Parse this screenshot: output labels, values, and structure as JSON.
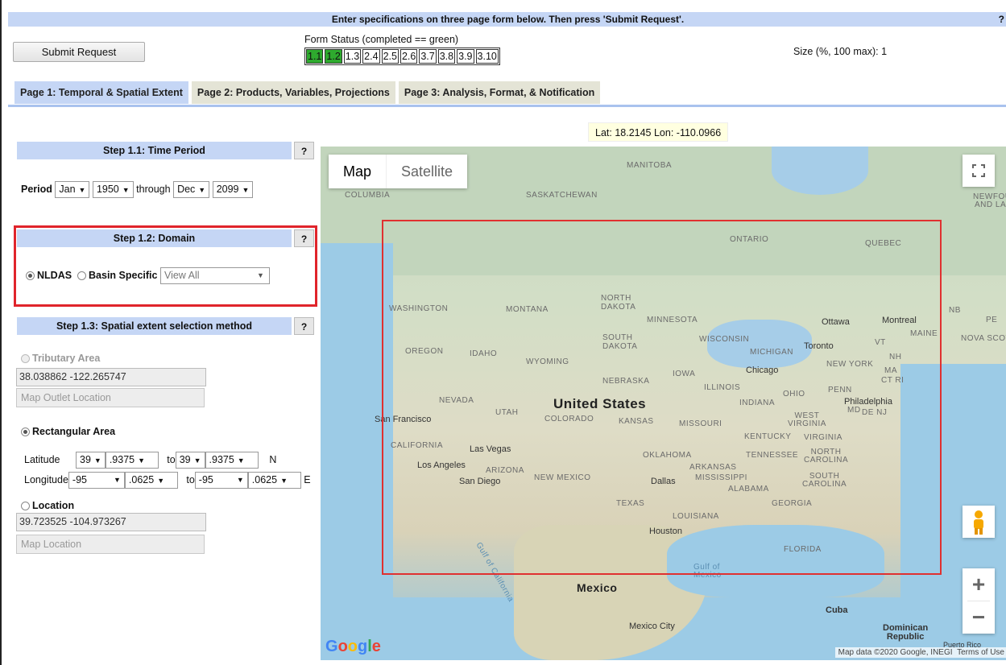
{
  "header": {
    "instructions": "Enter specifications on three page form below. Then press 'Submit Request'.",
    "help": "?"
  },
  "submit_label": "Submit Request",
  "form_status": {
    "label": "Form Status (completed == green)",
    "items": [
      {
        "label": "1.1",
        "done": true
      },
      {
        "label": "1.2",
        "done": true
      },
      {
        "label": "1.3",
        "done": false
      },
      {
        "label": "2.4",
        "done": false
      },
      {
        "label": "2.5",
        "done": false
      },
      {
        "label": "2.6",
        "done": false
      },
      {
        "label": "3.7",
        "done": false
      },
      {
        "label": "3.8",
        "done": false
      },
      {
        "label": "3.9",
        "done": false
      },
      {
        "label": "3.10",
        "done": false
      }
    ],
    "done_color": "#2eaa2e"
  },
  "size_text": "Size (%, 100 max): 1",
  "tabs": [
    {
      "label": "Page 1: Temporal & Spatial Extent",
      "active": true
    },
    {
      "label": "Page 2: Products, Variables, Projections",
      "active": false
    },
    {
      "label": "Page 3: Analysis, Format, & Notification",
      "active": false
    }
  ],
  "latlon_readout": "Lat: 18.2145 Lon: -110.0966",
  "step1": {
    "title": "Step 1.1: Time Period",
    "help": "?",
    "period_label": "Period",
    "start_month": "Jan",
    "start_year": "1950",
    "through": "through",
    "end_month": "Dec",
    "end_year": "2099"
  },
  "step2": {
    "title": "Step 1.2: Domain",
    "help": "?",
    "nldas_label": "NLDAS",
    "basin_label": "Basin Specific",
    "basin_select": "View All",
    "highlight_color": "#e0242b"
  },
  "step3": {
    "title": "Step 1.3: Spatial extent selection method",
    "help": "?",
    "tributary_label": "Tributary Area",
    "tributary_value": "38.038862 -122.265747",
    "map_outlet_btn": "Map Outlet Location",
    "rect_label": "Rectangular Area",
    "latitude_label": "Latitude",
    "lat_from_deg": "39",
    "lat_from_frac": ".9375",
    "to1": "to",
    "lat_to_deg": "39",
    "lat_to_frac": ".9375",
    "lat_dir": "N",
    "longitude_label": "Longitude",
    "lon_from_deg": "-95",
    "lon_from_frac": ".0625",
    "to2": "to",
    "lon_to_deg": "-95",
    "lon_to_frac": ".0625",
    "lon_dir": "E",
    "location_label": "Location",
    "location_value": "39.723525 -104.973267",
    "map_location_btn": "Map Location"
  },
  "map": {
    "type_map": "Map",
    "type_satellite": "Satellite",
    "zoom_in": "+",
    "zoom_out": "−",
    "attribution": "Map data ©2020 Google, INEGI",
    "terms": "Terms of Use",
    "google": [
      "G",
      "o",
      "o",
      "g",
      "l",
      "e"
    ],
    "selection_color": "#e03030",
    "labels": {
      "manitoba": "MANITOBA",
      "columbia": "COLUMBIA",
      "saskatchewan": "SASKATCHEWAN",
      "newfoundland": "NEWFOUN",
      "andlab": "AND LAB",
      "ontario": "ONTARIO",
      "quebec": "QUEBEC",
      "north_dakota": "NORTH\nDAKOTA",
      "washington": "WASHINGTON",
      "montana": "MONTANA",
      "minnesota": "MINNESOTA",
      "nb": "NB",
      "pe": "PE",
      "ottawa": "Ottawa",
      "montreal": "Montreal",
      "maine": "MAINE",
      "nova_scotia": "NOVA SCOTI",
      "south_dakota": "SOUTH\nDAKOTA",
      "wisconsin": "WISCONSIN",
      "toronto": "Toronto",
      "vt": "VT",
      "oregon": "OREGON",
      "idaho": "IDAHO",
      "wyoming": "WYOMING",
      "michigan": "MICHIGAN",
      "nh": "NH",
      "new_york": "NEW YORK",
      "ma": "MA",
      "ct_ri": "CT RI",
      "chicago": "Chicago",
      "iowa": "IOWA",
      "nebraska": "NEBRASKA",
      "illinois": "ILLINOIS",
      "ohio": "OHIO",
      "penn": "PENN",
      "nevada": "NEVADA",
      "utah": "UTAH",
      "united_states": "United States",
      "colorado": "COLORADO",
      "indiana": "INDIANA",
      "philadelphia": "Philadelphia",
      "md": "MD",
      "de_nj": "DE NJ",
      "san_francisco": "San Francisco",
      "kansas": "KANSAS",
      "missouri": "MISSOURI",
      "west_virginia": "WEST\nVIRGINIA",
      "kentucky": "KENTUCKY",
      "virginia": "VIRGINIA",
      "california": "CALIFORNIA",
      "las_vegas": "Las Vegas",
      "oklahoma": "OKLAHOMA",
      "tennessee": "TENNESSEE",
      "north_carolina": "NORTH\nCAROLINA",
      "los_angeles": "Los Angeles",
      "arizona": "ARIZONA",
      "arkansas": "ARKANSAS",
      "san_diego": "San Diego",
      "new_mexico": "NEW MEXICO",
      "dallas": "Dallas",
      "mississippi": "MISSISSIPPI",
      "south_carolina": "SOUTH\nCAROLINA",
      "alabama": "ALABAMA",
      "georgia": "GEORGIA",
      "texas": "TEXAS",
      "louisiana": "LOUISIANA",
      "houston": "Houston",
      "gulf_of_california": "Gulf of California",
      "florida": "FLORIDA",
      "gulf_of_mexico": "Gulf of\nMexico",
      "mexico": "Mexico",
      "cuba": "Cuba",
      "mexico_city": "Mexico City",
      "dominican_republic": "Dominican\nRepublic",
      "puerto_rico": "Puerto Rico"
    }
  }
}
